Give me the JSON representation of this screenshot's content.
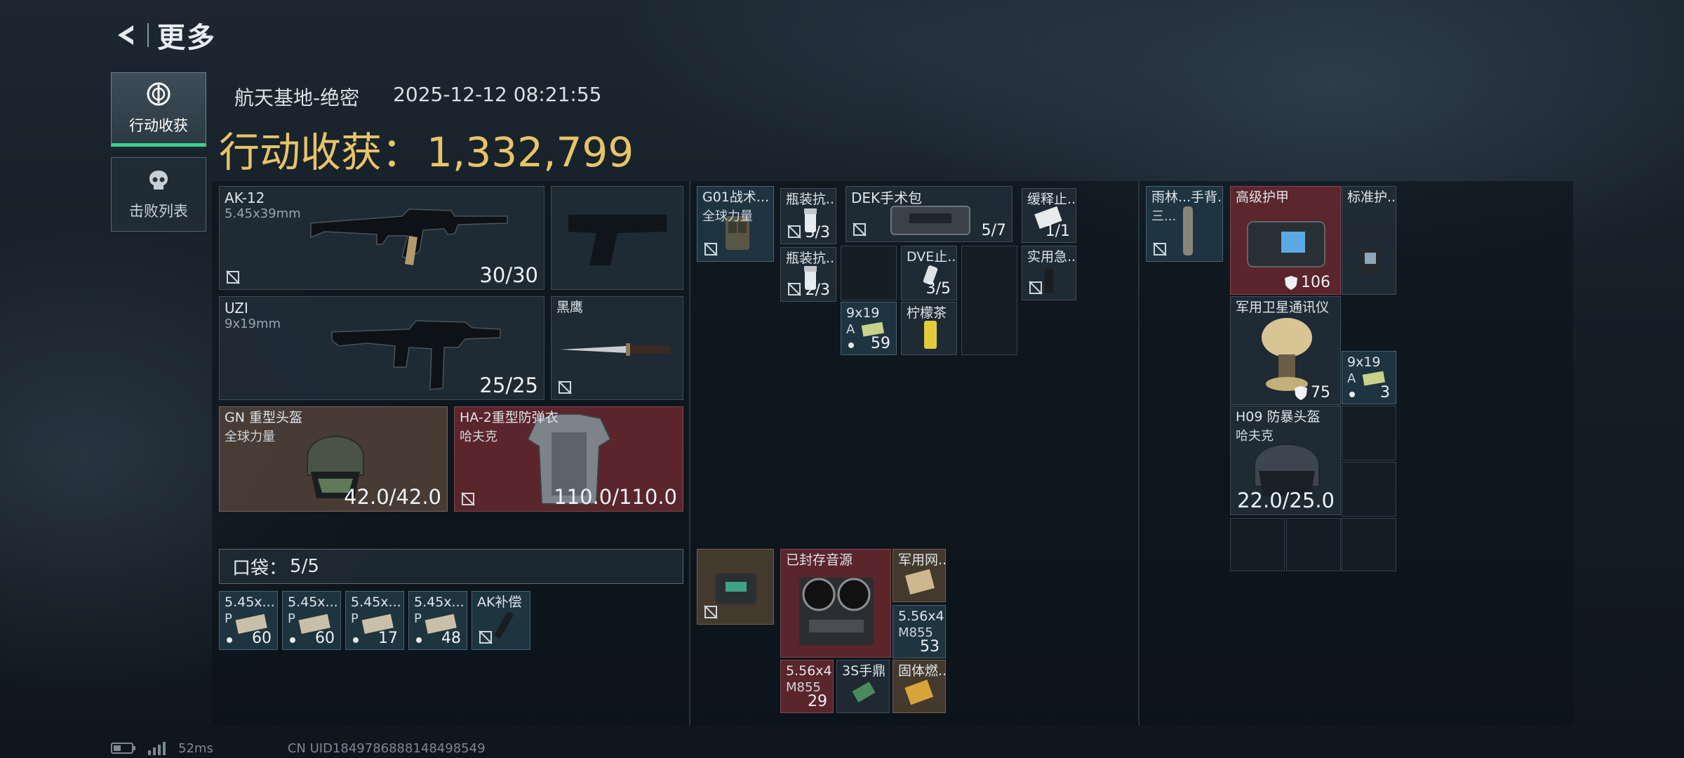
{
  "header": {
    "title": "更多"
  },
  "nav": [
    {
      "label": "行动收获",
      "icon": "dollar-coin-icon",
      "active": true
    },
    {
      "label": "击败列表",
      "icon": "skull-icon",
      "active": false
    }
  ],
  "raid": {
    "map": "航天基地-绝密",
    "datetime": "2025-12-12 08:21:55"
  },
  "gain": {
    "label": "行动收获",
    "colon": "：",
    "value": "1,332,799"
  },
  "loadout": {
    "primary": {
      "name": "AK-12",
      "caliber": "5.45x39mm",
      "ammo": "30/30"
    },
    "secondary": {
      "name": "UZI",
      "caliber": "9x19mm",
      "ammo": "25/25"
    },
    "pistol": {
      "name": ""
    },
    "melee": {
      "name": "黑鹰"
    },
    "helmet": {
      "name": "GN 重型头盔",
      "brand": "全球力量",
      "durability": "42.0/42.0"
    },
    "armor": {
      "name": "HA-2重型防弹衣",
      "brand": "哈夫克",
      "durability": "110.0/110.0"
    }
  },
  "pocket": {
    "label": "口袋",
    "colon": "：",
    "count": "5/5",
    "items": [
      {
        "name": "5.45x...",
        "sub": "P",
        "count": "60"
      },
      {
        "name": "5.45x...",
        "sub": "P",
        "count": "60"
      },
      {
        "name": "5.45x...",
        "sub": "P",
        "count": "17"
      },
      {
        "name": "5.45x...",
        "sub": "P",
        "count": "48"
      },
      {
        "name": "AK补偿"
      }
    ]
  },
  "rig": {
    "items": [
      {
        "name": "G01战术...",
        "sub": "全球力量"
      },
      {
        "name": "瓶装抗...",
        "count": "3/3"
      },
      {
        "name": "瓶装抗...",
        "count": "2/3"
      },
      {
        "name": "DEK手术包",
        "count": "5/7"
      },
      {
        "name": "DVE止...",
        "count": "3/5"
      },
      {
        "name": "柠檬茶"
      },
      {
        "name": "9x19",
        "sub": "A",
        "count": "59"
      },
      {
        "name": "缓释止...",
        "count": "1/1"
      },
      {
        "name": "实用急..."
      }
    ]
  },
  "backpack": {
    "items": [
      {
        "name": ""
      },
      {
        "name": "已封存音源"
      },
      {
        "name": "军用网..."
      },
      {
        "name": "5.56x4",
        "sub": "M855",
        "count": "53"
      },
      {
        "name": "5.56x4",
        "sub": "M855",
        "count": "29"
      },
      {
        "name": "3S手鼎"
      },
      {
        "name": "固体燃..."
      }
    ]
  },
  "safebox": {
    "items": [
      {
        "name": "雨林...手背...",
        "sub": "三..."
      },
      {
        "name": "高级护甲",
        "durability": "106"
      },
      {
        "name": "标准护..."
      },
      {
        "name": "军用卫星通讯仪",
        "durability": "75"
      },
      {
        "name": "9x19",
        "sub": "A",
        "count": "3"
      },
      {
        "name": "H09 防暴头盔",
        "sub": "哈夫克",
        "durability": "22.0/25.0"
      }
    ]
  },
  "status": {
    "ping": "52ms",
    "uid": "CN UID1849786888148498549"
  },
  "colors": {
    "gold": "#e8c466",
    "active_tab": "#37d48f",
    "red_slot": "#68282e",
    "teal_slot": "#20374a"
  }
}
